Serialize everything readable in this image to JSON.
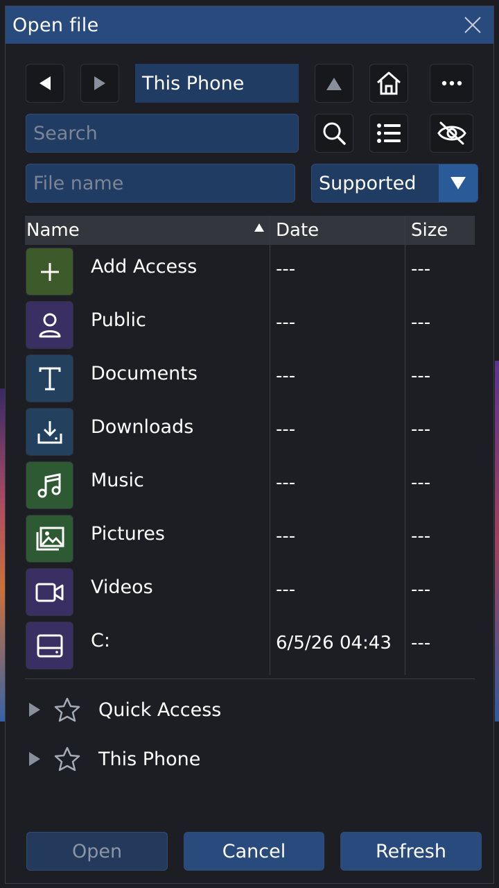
{
  "dialog": {
    "title": "Open file"
  },
  "nav": {
    "path": "This Phone"
  },
  "search": {
    "placeholder": "Search"
  },
  "filename": {
    "placeholder": "File name"
  },
  "filter": {
    "selected": "Supported"
  },
  "columns": {
    "name": "Name",
    "date": "Date",
    "size": "Size"
  },
  "files": [
    {
      "name": "Add Access",
      "date": "---",
      "size": "---",
      "icon": "plus-icon",
      "color": "#3c5a2a"
    },
    {
      "name": "Public",
      "date": "---",
      "size": "---",
      "icon": "user-icon",
      "color": "#3a2f63"
    },
    {
      "name": "Documents",
      "date": "---",
      "size": "---",
      "icon": "text-t-icon",
      "color": "#24405f"
    },
    {
      "name": "Downloads",
      "date": "---",
      "size": "---",
      "icon": "download-icon",
      "color": "#24405f"
    },
    {
      "name": "Music",
      "date": "---",
      "size": "---",
      "icon": "music-icon",
      "color": "#2e5a33"
    },
    {
      "name": "Pictures",
      "date": "---",
      "size": "---",
      "icon": "pictures-icon",
      "color": "#2e5a33"
    },
    {
      "name": "Videos",
      "date": "---",
      "size": "---",
      "icon": "video-icon",
      "color": "#3a2f63"
    },
    {
      "name": "C:",
      "date": "6/5/26 04:43",
      "size": "---",
      "icon": "drive-icon",
      "color": "#3a2f63"
    }
  ],
  "tree": [
    {
      "label": "Quick Access"
    },
    {
      "label": "This Phone"
    }
  ],
  "footer": {
    "open": "Open",
    "cancel": "Cancel",
    "refresh": "Refresh"
  }
}
